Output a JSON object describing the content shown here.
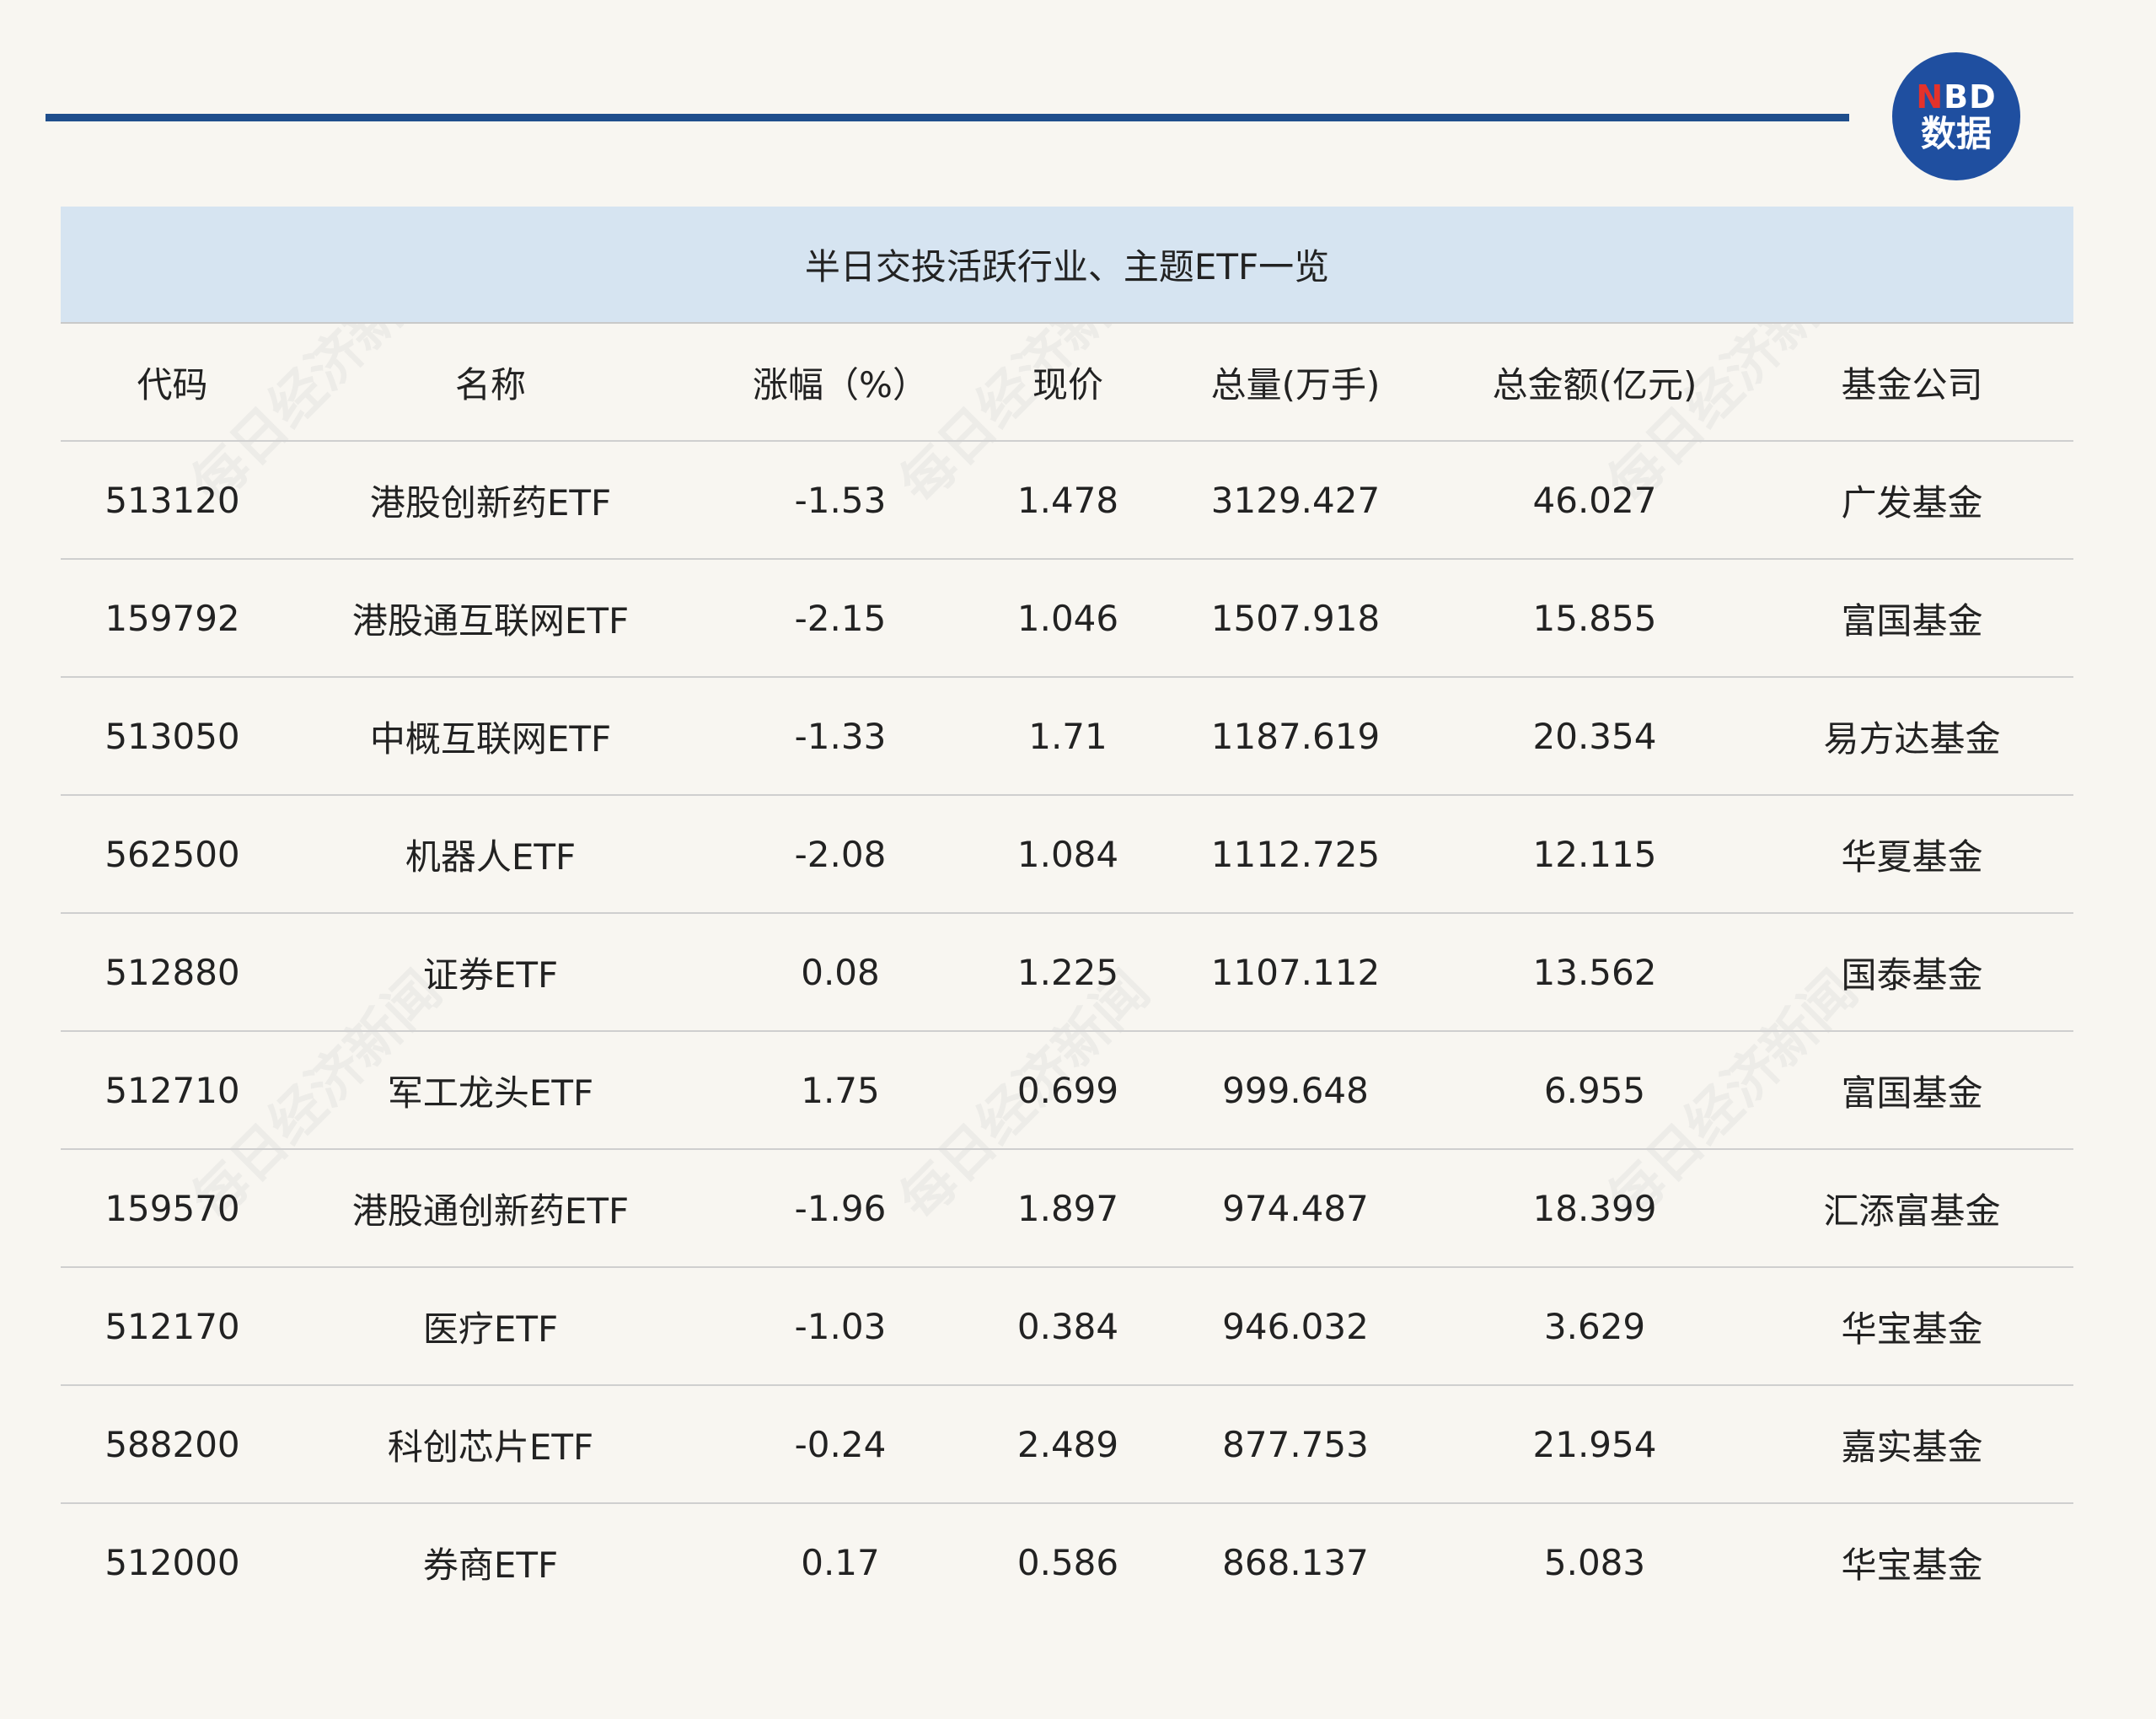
{
  "logo": {
    "line1": "NBD",
    "line2": "数据"
  },
  "watermark": "每日经济新闻",
  "table": {
    "caption": "半日交投活跃行业、主题ETF一览",
    "headers": [
      "代码",
      "名称",
      "涨幅（%）",
      "现价",
      "总量(万手)",
      "总金额(亿元)",
      "基金公司"
    ],
    "rows": [
      [
        "513120",
        "港股创新药ETF",
        "-1.53",
        "1.478",
        "3129.427",
        "46.027",
        "广发基金"
      ],
      [
        "159792",
        "港股通互联网ETF",
        "-2.15",
        "1.046",
        "1507.918",
        "15.855",
        "富国基金"
      ],
      [
        "513050",
        "中概互联网ETF",
        "-1.33",
        "1.71",
        "1187.619",
        "20.354",
        "易方达基金"
      ],
      [
        "562500",
        "机器人ETF",
        "-2.08",
        "1.084",
        "1112.725",
        "12.115",
        "华夏基金"
      ],
      [
        "512880",
        "证券ETF",
        "0.08",
        "1.225",
        "1107.112",
        "13.562",
        "国泰基金"
      ],
      [
        "512710",
        "军工龙头ETF",
        "1.75",
        "0.699",
        "999.648",
        "6.955",
        "富国基金"
      ],
      [
        "159570",
        "港股通创新药ETF",
        "-1.96",
        "1.897",
        "974.487",
        "18.399",
        "汇添富基金"
      ],
      [
        "512170",
        "医疗ETF",
        "-1.03",
        "0.384",
        "946.032",
        "3.629",
        "华宝基金"
      ],
      [
        "588200",
        "科创芯片ETF",
        "-0.24",
        "2.489",
        "877.753",
        "21.954",
        "嘉实基金"
      ],
      [
        "512000",
        "券商ETF",
        "0.17",
        "0.586",
        "868.137",
        "5.083",
        "华宝基金"
      ]
    ]
  },
  "colors": {
    "background": "#f8f6f1",
    "accent_rule": "#1f4e8c",
    "caption_bg": "#d6e4f1",
    "logo_bg": "#1f4fa0",
    "logo_accent": "#e4322b"
  }
}
